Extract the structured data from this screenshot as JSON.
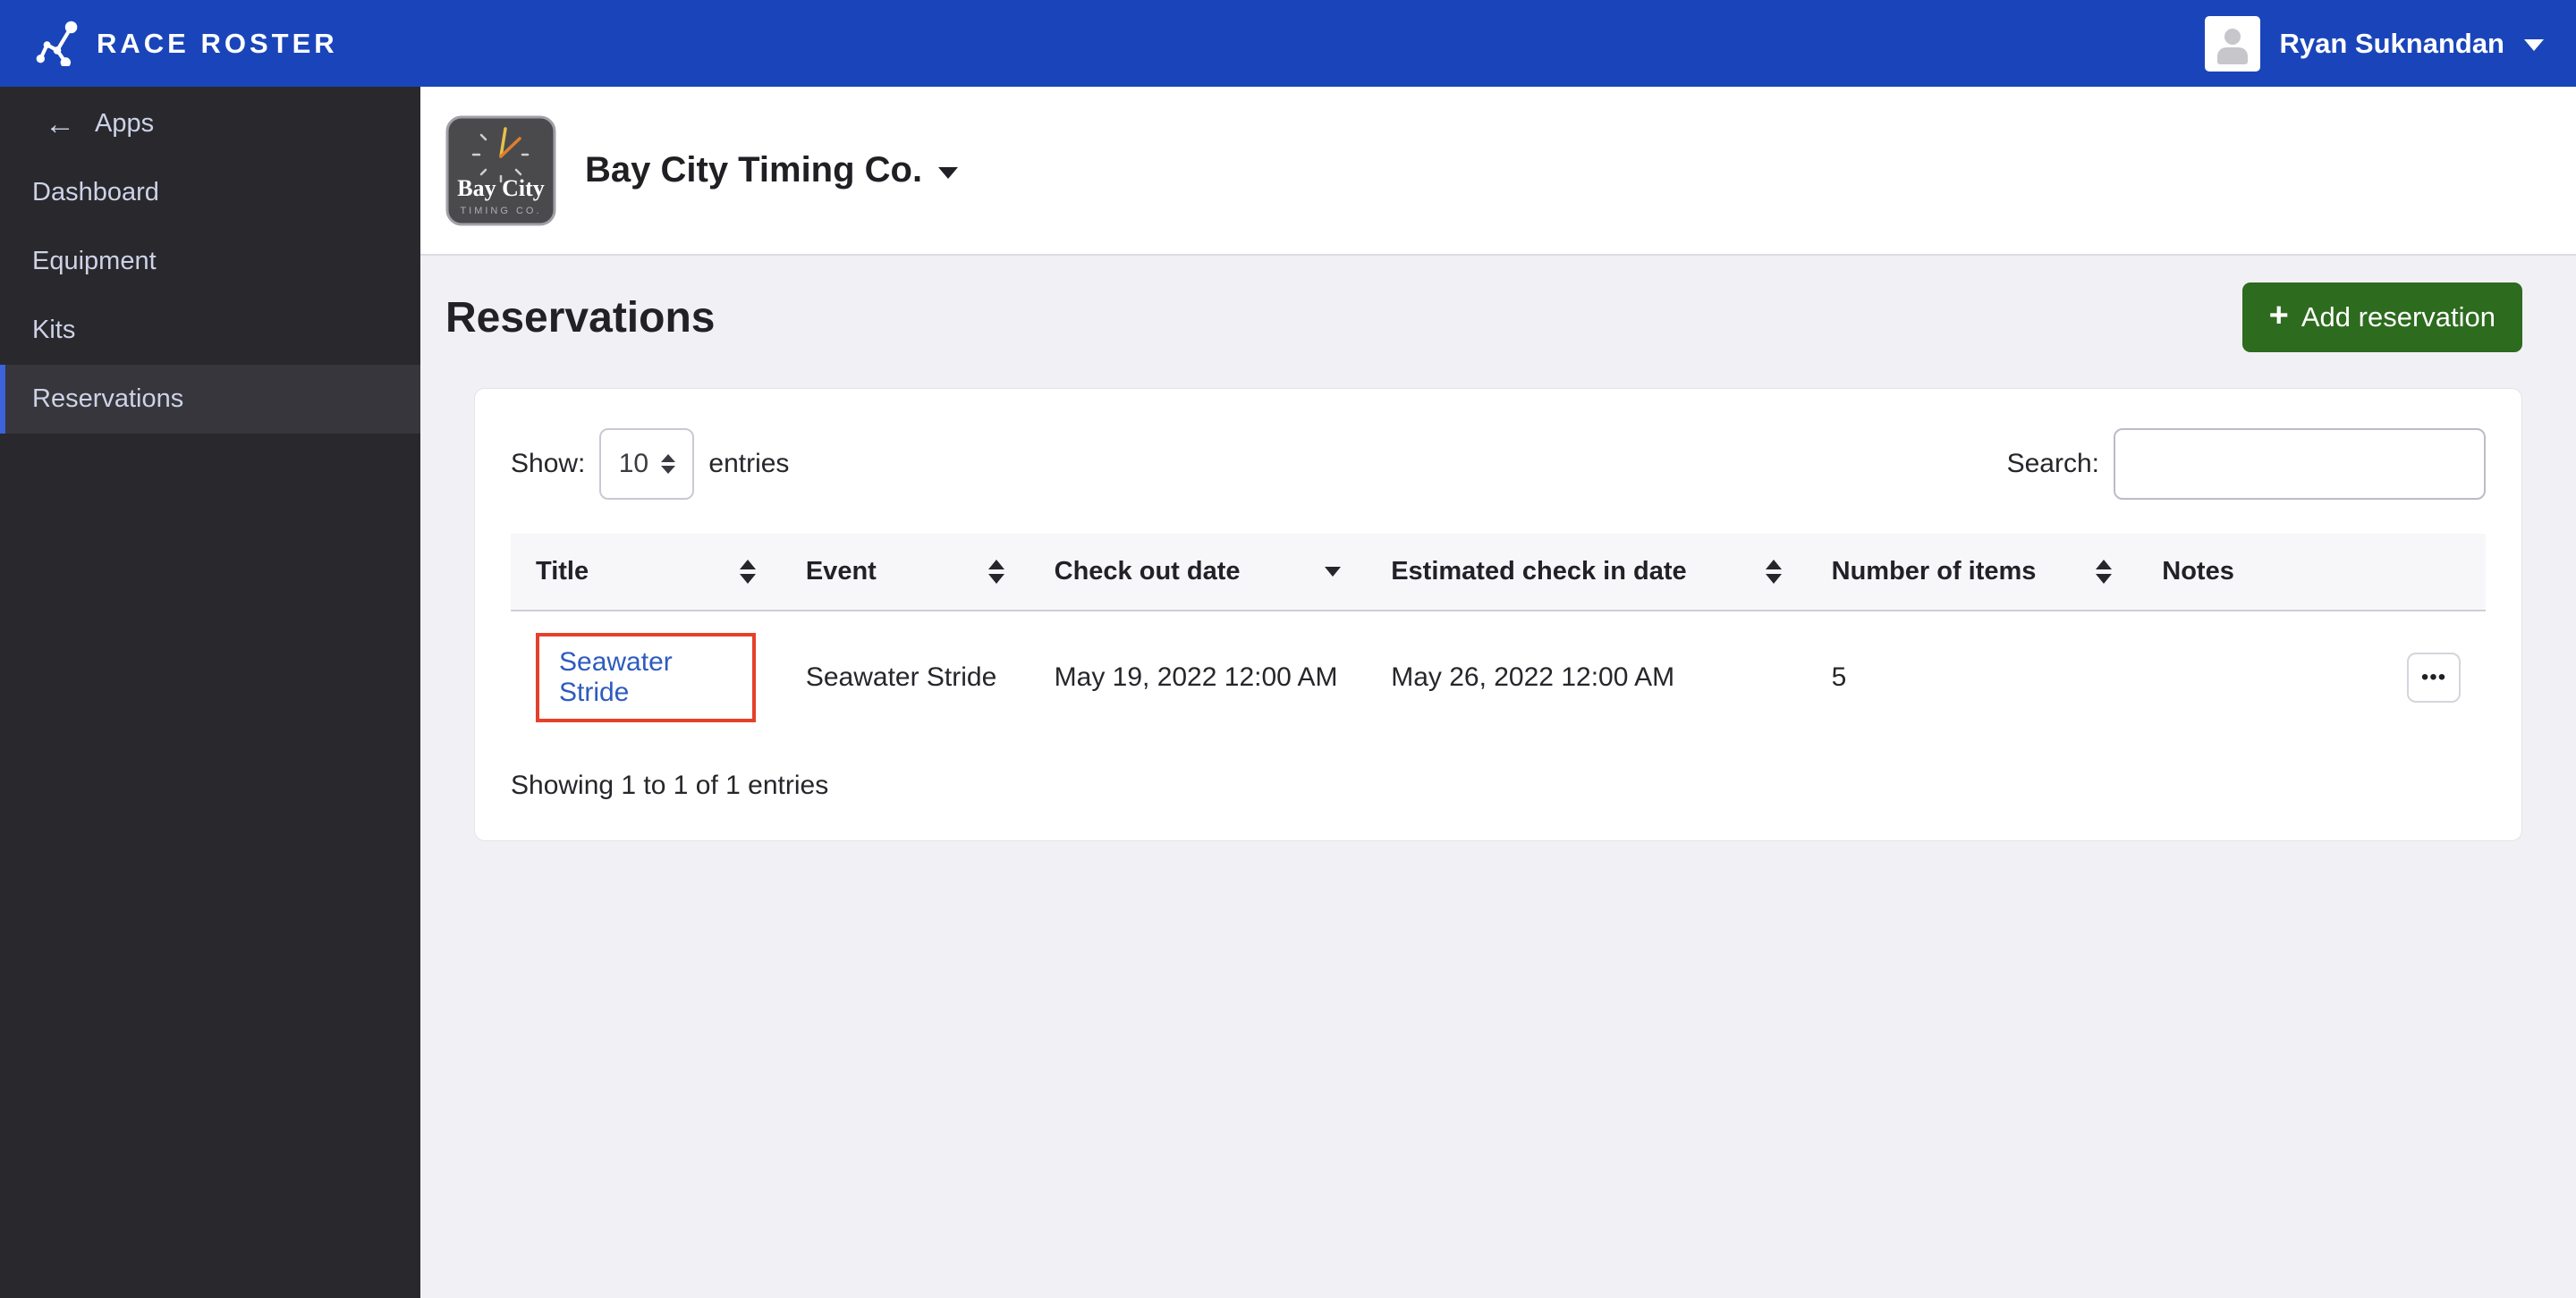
{
  "topbar": {
    "brand": "RACE ROSTER",
    "user_name": "Ryan Suknandan"
  },
  "sidebar": {
    "back_label": "Apps",
    "items": [
      {
        "label": "Dashboard",
        "active": false
      },
      {
        "label": "Equipment",
        "active": false
      },
      {
        "label": "Kits",
        "active": false
      },
      {
        "label": "Reservations",
        "active": true
      }
    ]
  },
  "org_header": {
    "name": "Bay City Timing Co.",
    "logo_line1": "Bay City",
    "logo_line2": "TIMING CO."
  },
  "page": {
    "title": "Reservations",
    "add_button_label": "Add reservation"
  },
  "table_controls": {
    "show_label": "Show:",
    "page_size": "10",
    "entries_label": "entries",
    "search_label": "Search:",
    "search_value": ""
  },
  "table": {
    "columns": [
      {
        "label": "Title",
        "sort": "both"
      },
      {
        "label": "Event",
        "sort": "both"
      },
      {
        "label": "Check out date",
        "sort": "desc"
      },
      {
        "label": "Estimated check in date",
        "sort": "both"
      },
      {
        "label": "Number of items",
        "sort": "both"
      },
      {
        "label": "Notes",
        "sort": "none"
      }
    ],
    "rows": [
      {
        "title": "Seawater Stride",
        "event": "Seawater Stride",
        "check_out_date": "May 19, 2022 12:00 AM",
        "check_in_date": "May 26, 2022 12:00 AM",
        "number_of_items": "5",
        "notes": ""
      }
    ],
    "summary": "Showing 1 to 1 of 1 entries"
  },
  "icons": {
    "plus": "+",
    "back_arrow": "←",
    "more": "•••"
  },
  "colors": {
    "topbar_blue": "#1a45ba",
    "sidebar_dark": "#28282d",
    "sidebar_active": "#36363c",
    "active_border_blue": "#3c63dc",
    "button_green": "#2d6b1f",
    "link_blue": "#2d5bbf",
    "highlight_red": "#e5402a",
    "content_bg": "#f1f1f5"
  }
}
